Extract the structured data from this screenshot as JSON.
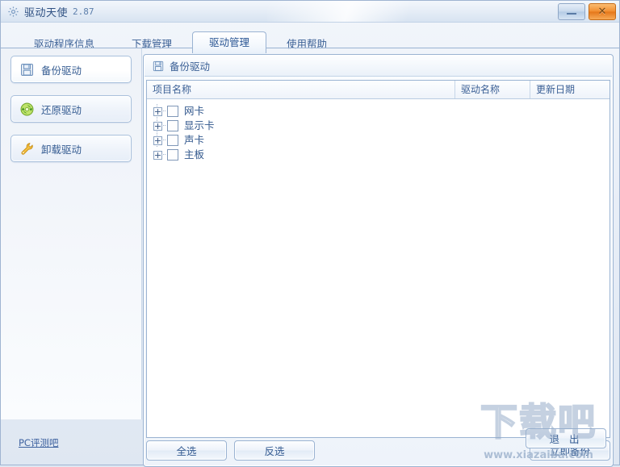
{
  "window": {
    "title": "驱动天使",
    "version": "2.87",
    "app_icon": "gear-icon",
    "minimize_label": "—",
    "close_label": "✕",
    "accent": "#2b5694",
    "close_color": "#ef8b2c"
  },
  "tabs": [
    {
      "label": "驱动程序信息",
      "active": false
    },
    {
      "label": "下载管理",
      "active": false
    },
    {
      "label": "驱动管理",
      "active": true
    },
    {
      "label": "使用帮助",
      "active": false
    }
  ],
  "sidebar": {
    "items": [
      {
        "label": "备份驱动",
        "icon": "floppy-disk-icon",
        "active": true
      },
      {
        "label": "还原驱动",
        "icon": "refresh-circle-icon",
        "active": false
      },
      {
        "label": "卸载驱动",
        "icon": "wrench-icon",
        "active": false
      }
    ],
    "footer_link": "PC评测吧"
  },
  "panel": {
    "title": "备份驱动",
    "icon": "floppy-disk-icon",
    "columns": [
      "项目名称",
      "驱动名称",
      "更新日期"
    ],
    "rows": [
      {
        "name": "网卡",
        "driver": "",
        "date": "",
        "checked": false,
        "expanded": false
      },
      {
        "name": "显示卡",
        "driver": "",
        "date": "",
        "checked": false,
        "expanded": false
      },
      {
        "name": "声卡",
        "driver": "",
        "date": "",
        "checked": false,
        "expanded": false
      },
      {
        "name": "主板",
        "driver": "",
        "date": "",
        "checked": false,
        "expanded": false
      }
    ],
    "buttons": {
      "select_all": "全选",
      "invert": "反选",
      "backup_now": "立即备份"
    }
  },
  "bottom": {
    "exit": "退  出"
  },
  "watermark": {
    "big": "下载吧",
    "small": "www.xiazaiba.com"
  }
}
